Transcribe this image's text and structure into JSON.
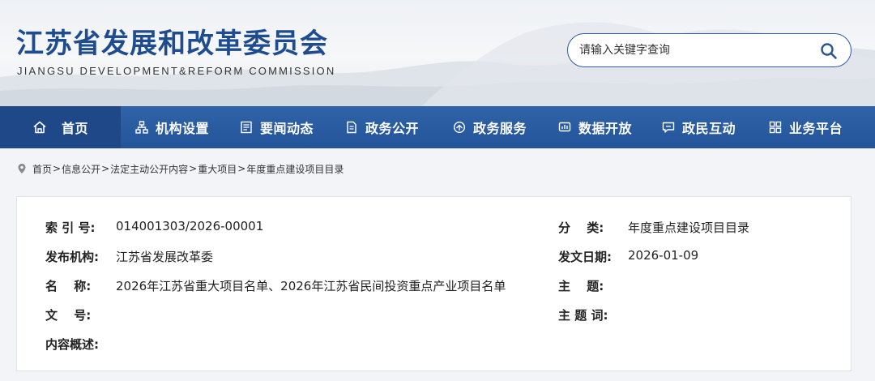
{
  "header": {
    "title": "江苏省发展和改革委员会",
    "subtitle": "JIANGSU DEVELOPMENT&REFORM COMMISSION",
    "search_placeholder": "请输入关键字查询",
    "brand_color": "#1e4c8f"
  },
  "nav": {
    "items": [
      {
        "label": "首页",
        "icon": "home-icon"
      },
      {
        "label": "机构设置",
        "icon": "org-chart-icon"
      },
      {
        "label": "要闻动态",
        "icon": "news-icon"
      },
      {
        "label": "政务公开",
        "icon": "document-icon"
      },
      {
        "label": "政务服务",
        "icon": "service-icon"
      },
      {
        "label": "数据开放",
        "icon": "data-icon"
      },
      {
        "label": "政民互动",
        "icon": "chat-icon"
      },
      {
        "label": "业务平台",
        "icon": "grid-icon"
      }
    ],
    "color": "#2a5ba0",
    "active_color": "#1e4888"
  },
  "breadcrumb": {
    "items": [
      "首页",
      "信息公开",
      "法定主动公开内容",
      "重大项目",
      "年度重点建设项目目录"
    ],
    "separator": ">"
  },
  "info": {
    "index_label": "索 引 号:",
    "index_value": "014001303/2026-00001",
    "category_label": "分　 类:",
    "category_value": "年度重点建设项目目录",
    "publisher_label": "发布机构:",
    "publisher_value": "江苏省发展改革委",
    "date_label": "发文日期:",
    "date_value": "2026-01-09",
    "name_label": "名　 称:",
    "name_value": "2026年江苏省重大项目名单、2026年江苏省民间投资重点产业项目名单",
    "subject_label": "主　 题:",
    "subject_value": "",
    "docno_label": "文　 号:",
    "docno_value": "",
    "keywords_label": "主 题 词:",
    "keywords_value": "",
    "summary_label": "内容概述:",
    "summary_value": ""
  }
}
